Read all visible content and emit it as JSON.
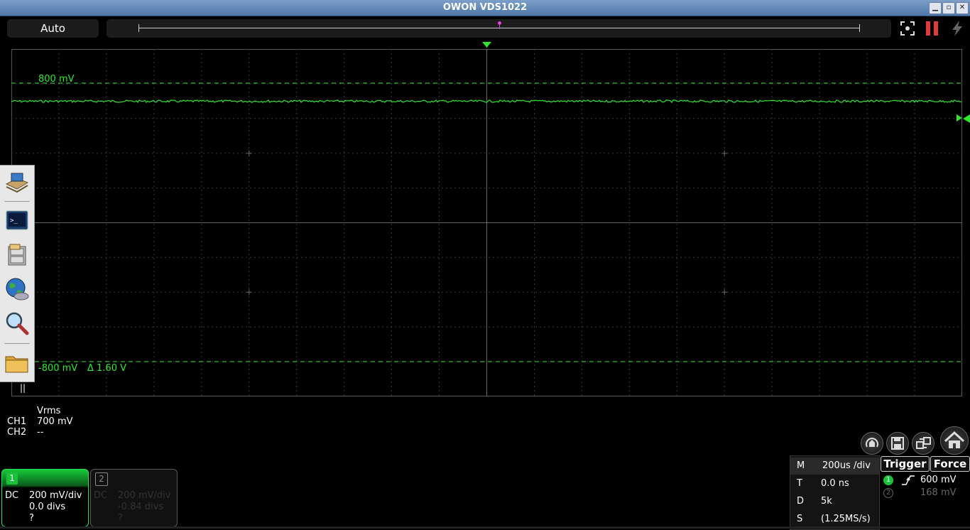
{
  "window": {
    "title": "OWON VDS1022"
  },
  "toolbar": {
    "mode_label": "Auto"
  },
  "scope": {
    "upper_cursor_label": "800 mV",
    "lower_cursor_label": "-800 mV",
    "delta_label": "Δ 1.60 V",
    "trace_color": "#2ee82e",
    "cursor_color": "#2ee82e"
  },
  "tools": [
    "desktop-icon",
    "terminal-icon",
    "file-cabinet-icon",
    "globe-icon",
    "magnifier-icon",
    "folder-icon"
  ],
  "tool_panel_handle": "||",
  "measurements": {
    "header": "Vrms",
    "rows": [
      {
        "channel": "CH1",
        "value": "700 mV"
      },
      {
        "channel": "CH2",
        "value": "--"
      }
    ]
  },
  "channels": [
    {
      "number": "1",
      "coupling": "DC",
      "scale": "200 mV/div",
      "offset": "0.0 divs",
      "probe": "?"
    },
    {
      "number": "2",
      "coupling": "DC",
      "scale": "200 mV/div",
      "offset": "-0.84 divs",
      "probe": "?"
    }
  ],
  "timebase": {
    "rows": [
      {
        "key": "M",
        "value": "200us /div"
      },
      {
        "key": "T",
        "value": "0.0 ns"
      },
      {
        "key": "D",
        "value": "5k"
      },
      {
        "key": "S",
        "value": "(1.25MS/s)"
      }
    ]
  },
  "trigger": {
    "trigger_label": "Trigger",
    "force_label": "Force",
    "ch1": {
      "num": "1",
      "level": "600 mV"
    },
    "ch2": {
      "num": "2",
      "level": "168 mV"
    }
  }
}
